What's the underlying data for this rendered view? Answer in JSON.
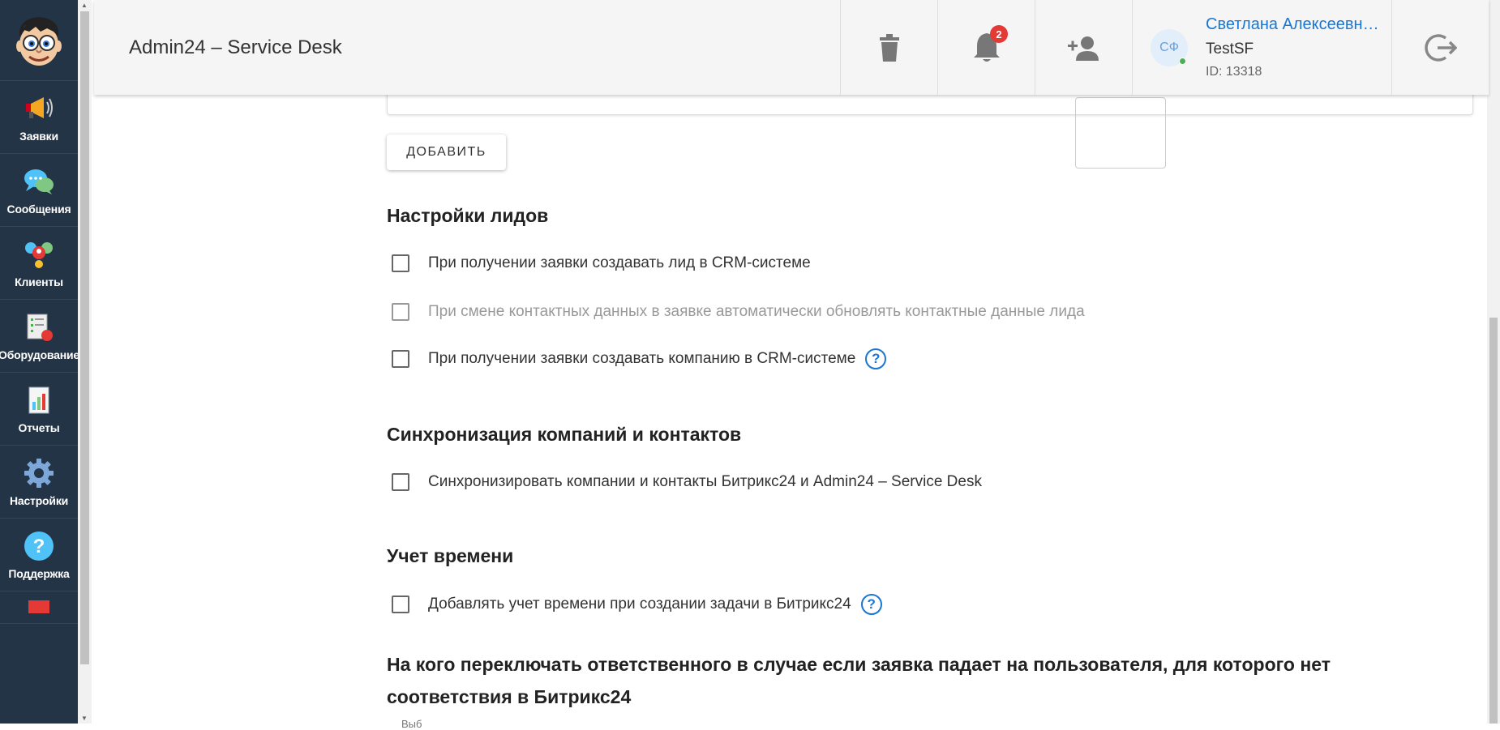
{
  "sidebar": {
    "items": [
      {
        "label": "Заявки",
        "icon": "megaphone-icon"
      },
      {
        "label": "Сообщения",
        "icon": "chat-bubbles-icon"
      },
      {
        "label": "Клиенты",
        "icon": "clients-icon"
      },
      {
        "label": "Оборудование",
        "icon": "equipment-icon"
      },
      {
        "label": "Отчеты",
        "icon": "reports-icon"
      },
      {
        "label": "Настройки",
        "icon": "gear-icon"
      },
      {
        "label": "Поддержка",
        "icon": "help-icon"
      }
    ]
  },
  "header": {
    "title": "Admin24 – Service Desk",
    "notifications_count": "2",
    "user": {
      "initials": "СФ",
      "name": "Светлана Алексеевна Ф",
      "org": "TestSF",
      "id": "ID: 13318"
    }
  },
  "content": {
    "add_button": "ДОБАВИТЬ",
    "leads": {
      "title": "Настройки лидов",
      "options": [
        {
          "label": "При получении заявки создавать лид в CRM-системе",
          "checked": false,
          "disabled": false
        },
        {
          "label": "При смене контактных данных в заявке автоматически обновлять контактные данные лида",
          "checked": false,
          "disabled": true
        },
        {
          "label": "При получении заявки создавать компанию в CRM-системе",
          "checked": false,
          "disabled": false
        }
      ]
    },
    "sync": {
      "title": "Синхронизация компаний и контактов",
      "options": [
        {
          "label": "Синхронизировать компании и контакты Битрикс24 и Admin24 – Service Desk",
          "checked": false
        }
      ]
    },
    "time": {
      "title": "Учет времени",
      "options": [
        {
          "label": "Добавлять учет времени при создании задачи в Битрикс24",
          "checked": false
        }
      ]
    },
    "responsible": {
      "title": "На кого переключать ответственного в случае если заявка падает на пользователя, для которого нет соответствия в Битрикс24",
      "field_label": "Выб"
    }
  }
}
